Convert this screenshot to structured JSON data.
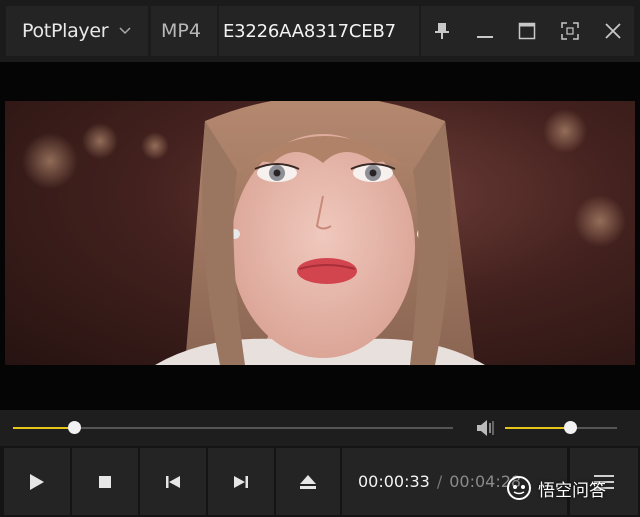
{
  "titlebar": {
    "app_name": "PotPlayer",
    "format": "MP4",
    "filename": "E3226AA8317CEB7"
  },
  "window_buttons": [
    "pin-icon",
    "minimize-icon",
    "maximize-icon",
    "fullscreen-icon",
    "close-icon"
  ],
  "playback": {
    "current_time": "00:00:33",
    "separator": "/",
    "total_time": "00:04:28",
    "seek_progress": 0.138,
    "volume_level": 0.58
  },
  "controls": [
    "play-icon",
    "stop-icon",
    "previous-icon",
    "next-icon",
    "eject-icon",
    "menu-icon"
  ],
  "colors": {
    "accent": "#e6c41a",
    "panel": "#242424",
    "background": "#141414"
  },
  "watermark": {
    "text": "悟空问答"
  }
}
